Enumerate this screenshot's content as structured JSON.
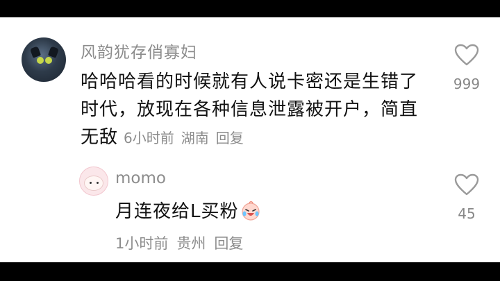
{
  "comment": {
    "username": "风韵犹存俏寡妇",
    "text": "哈哈哈看的时候就有人说卡密还是生错了时代，放现在各种信息泄露被开户，简直无敌",
    "time": "6小时前",
    "location": "湖南",
    "reply_label": "回复",
    "like_count": "999"
  },
  "reply": {
    "username": "momo",
    "text": "月连夜给L买粉",
    "emoji": "laughing-crying-face-icon",
    "time": "1小时前",
    "location": "贵州",
    "reply_label": "回复",
    "like_count": "45"
  },
  "colors": {
    "text_primary": "#111111",
    "text_secondary": "#8c8c8c",
    "background": "#ffffff",
    "letterbox": "#000000"
  }
}
